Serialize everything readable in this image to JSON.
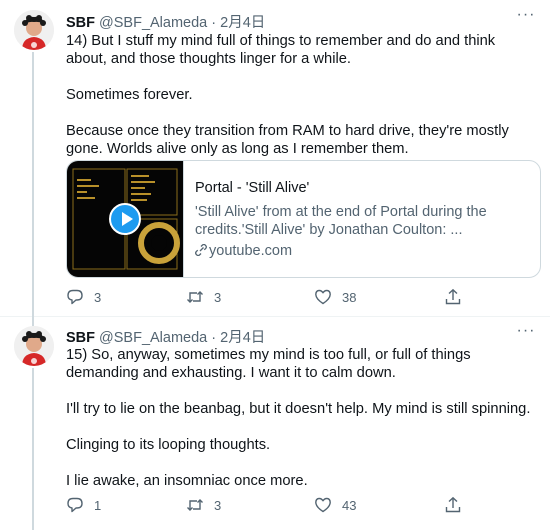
{
  "tweets": [
    {
      "author": {
        "name": "SBF",
        "handle": "@SBF_Alameda",
        "separator": "·",
        "date": "2月4日"
      },
      "more_label": "···",
      "paragraphs": [
        "14) But I stuff my mind full of things to remember and do and think about, and those thoughts linger for a while.",
        "Sometimes forever.",
        "Because once they transition from RAM to hard drive, they're mostly gone. Worlds alive only as long as I remember them."
      ],
      "card": {
        "title": "Portal - 'Still Alive'",
        "description": "'Still Alive' from at the end of Portal during the credits.'Still Alive' by Jonathan Coulton: ...",
        "domain": "youtube.com"
      },
      "actions": {
        "reply_count": "3",
        "retweet_count": "3",
        "like_count": "38"
      }
    },
    {
      "author": {
        "name": "SBF",
        "handle": "@SBF_Alameda",
        "separator": "·",
        "date": "2月4日"
      },
      "more_label": "···",
      "paragraphs": [
        "15) So, anyway, sometimes my mind is too full, or full of things demanding and exhausting.  I want it to calm down.",
        "I'll try to lie on the beanbag, but it doesn't help.  My mind is still spinning.",
        "Clinging to its looping thoughts.",
        "I lie awake, an insomniac once more."
      ],
      "actions": {
        "reply_count": "1",
        "retweet_count": "3",
        "like_count": "43"
      }
    }
  ],
  "colors": {
    "accent": "#1d9bf0",
    "secondary_text": "#536471",
    "border": "#cfd9de"
  },
  "icons": [
    "avatar",
    "more-icon",
    "play-icon",
    "link-icon",
    "reply-icon",
    "retweet-icon",
    "like-icon",
    "share-icon"
  ]
}
